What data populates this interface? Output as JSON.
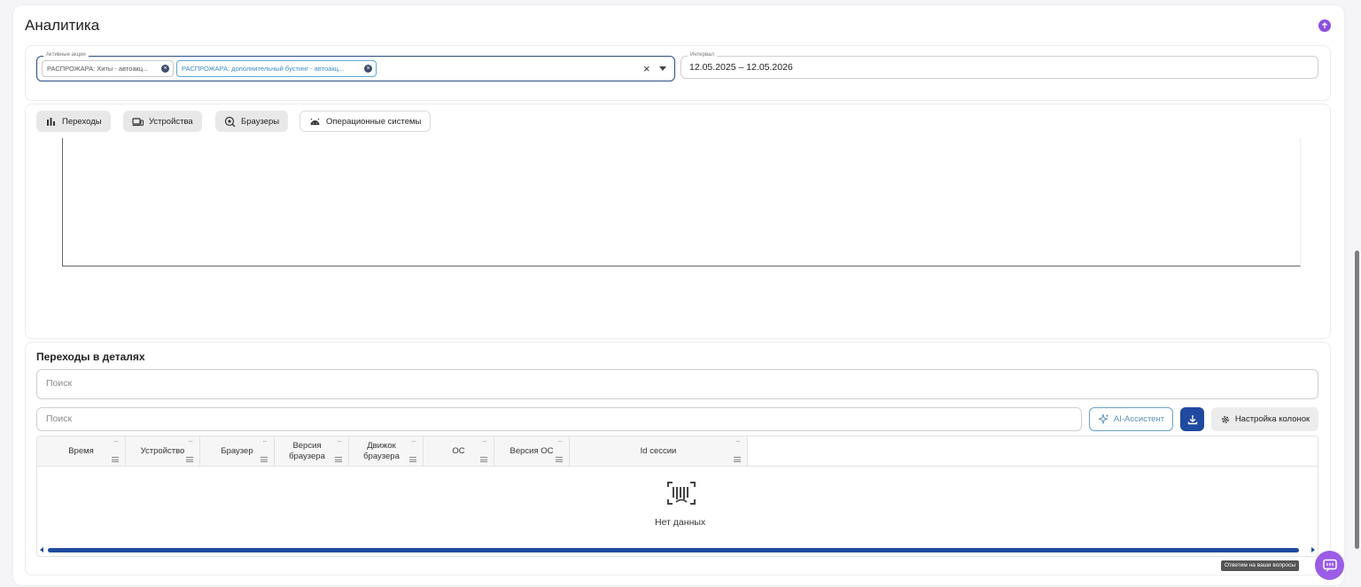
{
  "page": {
    "title": "Аналитика"
  },
  "filters": {
    "actions_label": "Активные акции",
    "chips": [
      "РАСПРОЖАРА: Хиты - автоакц...",
      "РАСПРОЖАРА: дополнительный бустинг - автоакц..."
    ],
    "interval_label": "Интервал",
    "interval_value": "12.05.2025 – 12.05.2026"
  },
  "tabs": [
    {
      "label": "Переходы",
      "icon": "bar-chart-icon"
    },
    {
      "label": "Устройства",
      "icon": "devices-icon"
    },
    {
      "label": "Браузеры",
      "icon": "browser-icon"
    },
    {
      "label": "Операционные системы",
      "icon": "android-icon"
    }
  ],
  "details": {
    "title": "Переходы в деталях",
    "search_placeholder_1": "Поиск",
    "search_placeholder_2": "Поиск",
    "ai_button": "AI-Ассистент",
    "columns_button": "Настройка колонок",
    "columns": [
      {
        "label": "Время"
      },
      {
        "label": "Устройство"
      },
      {
        "label": "Браузер"
      },
      {
        "label": "Версия браузера"
      },
      {
        "label": "Движок браузера"
      },
      {
        "label": "ОС"
      },
      {
        "label": "Версия ОС"
      },
      {
        "label": "Id сессии"
      }
    ],
    "empty_text": "Нет данных"
  },
  "help": {
    "tooltip": "Ответим на ваши вопросы"
  },
  "colors": {
    "accent_purple": "#9b5de5",
    "primary_blue": "#1f4aa0",
    "chip_active": "#3c8ec2"
  }
}
